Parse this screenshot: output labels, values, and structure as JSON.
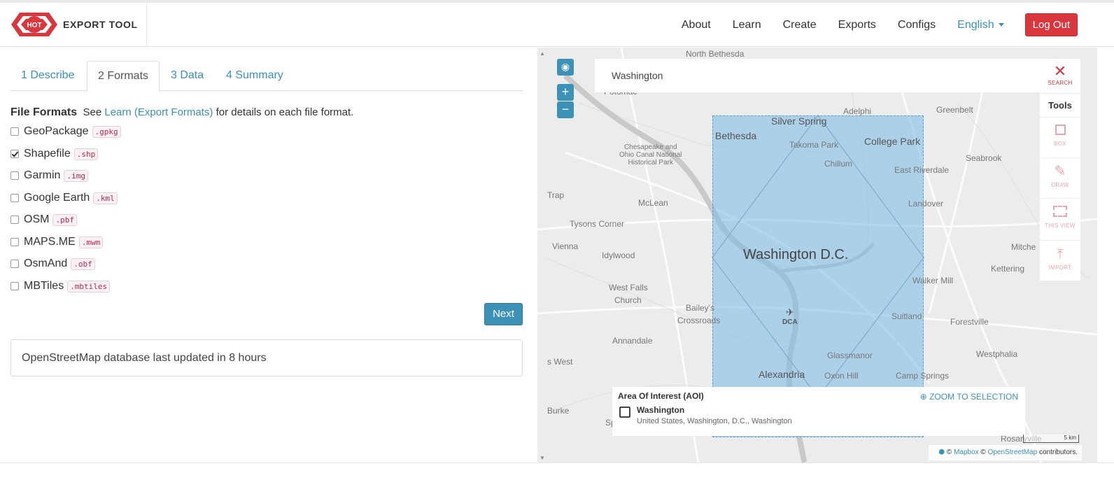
{
  "brand": {
    "logo_text": "HOT",
    "title": "EXPORT TOOL"
  },
  "nav": {
    "items": [
      "About",
      "Learn",
      "Create",
      "Exports",
      "Configs"
    ],
    "language": "English",
    "logout": "Log Out"
  },
  "tabs": [
    "1 Describe",
    "2 Formats",
    "3 Data",
    "4 Summary"
  ],
  "formats": {
    "heading": "File Formats",
    "see": "See",
    "link": "Learn (Export Formats)",
    "tail": "for details on each file format.",
    "items": [
      {
        "name": "GeoPackage",
        "ext": ".gpkg",
        "checked": false
      },
      {
        "name": "Shapefile",
        "ext": ".shp",
        "checked": true
      },
      {
        "name": "Garmin",
        "ext": ".img",
        "checked": false
      },
      {
        "name": "Google Earth",
        "ext": ".kml",
        "checked": false
      },
      {
        "name": "OSM",
        "ext": ".pbf",
        "checked": false
      },
      {
        "name": "MAPS.ME",
        "ext": ".mwm",
        "checked": false
      },
      {
        "name": "OsmAnd",
        "ext": ".obf",
        "checked": false
      },
      {
        "name": "MBTiles",
        "ext": ".mbtiles",
        "checked": false
      }
    ],
    "next": "Next"
  },
  "status": "OpenStreetMap database last updated in 8 hours",
  "map": {
    "search_value": "Washington",
    "tools": {
      "search": "SEARCH",
      "heading": "Tools",
      "box": "BOX",
      "draw": "DRAW",
      "this_view": "THIS VIEW",
      "import": "IMPORT"
    },
    "labels": {
      "north_bethesda": "North Bethesda",
      "potomac": "Potomac",
      "silver_spring": "Silver Spring",
      "adelphi": "Adelphi",
      "greenbelt": "Greenbelt",
      "bethesda": "Bethesda",
      "takoma_park": "Takoma Park",
      "college_park": "College Park",
      "canal_1": "Chesapeake and",
      "canal_2": "Ohio Canal National",
      "canal_3": "Historical Park",
      "chillum": "Chillum",
      "seabrook": "Seabrook",
      "east_riverdale": "East Riverdale",
      "trap": "Trap",
      "mclean": "McLean",
      "landover": "Landover",
      "tysons": "Tysons Corner",
      "vienna": "Vienna",
      "washington_dc": "Washington D.C.",
      "mitche": "Mitche",
      "idylwood": "Idylwood",
      "kettering": "Kettering",
      "walker_mill": "Walker Mill",
      "west_falls_1": "West Falls",
      "west_falls_2": "Church",
      "baileys_1": "Bailey's",
      "baileys_2": "Crossroads",
      "dca": "DCA",
      "suitland": "Suitland",
      "forestville": "Forestville",
      "annandale": "Annandale",
      "west": "s West",
      "glassmanor": "Glassmanor",
      "westphalia": "Westphalia",
      "alexandria": "Alexandria",
      "oxon_hill": "Oxon Hill",
      "camp_springs": "Camp Springs",
      "burke": "Burke",
      "spring": "Spring",
      "rosaryville": "Rosaryville"
    },
    "aoi": {
      "title": "Area Of Interest (AOI)",
      "zoom": "ZOOM TO SELECTION",
      "name": "Washington",
      "sub": "United States, Washington, D.C., Washington"
    },
    "scale": "5 km",
    "attribution": {
      "c1": "©",
      "mapbox": "Mapbox",
      "c2": "©",
      "osm": "OpenStreetMap",
      "tail": "contributors."
    }
  }
}
